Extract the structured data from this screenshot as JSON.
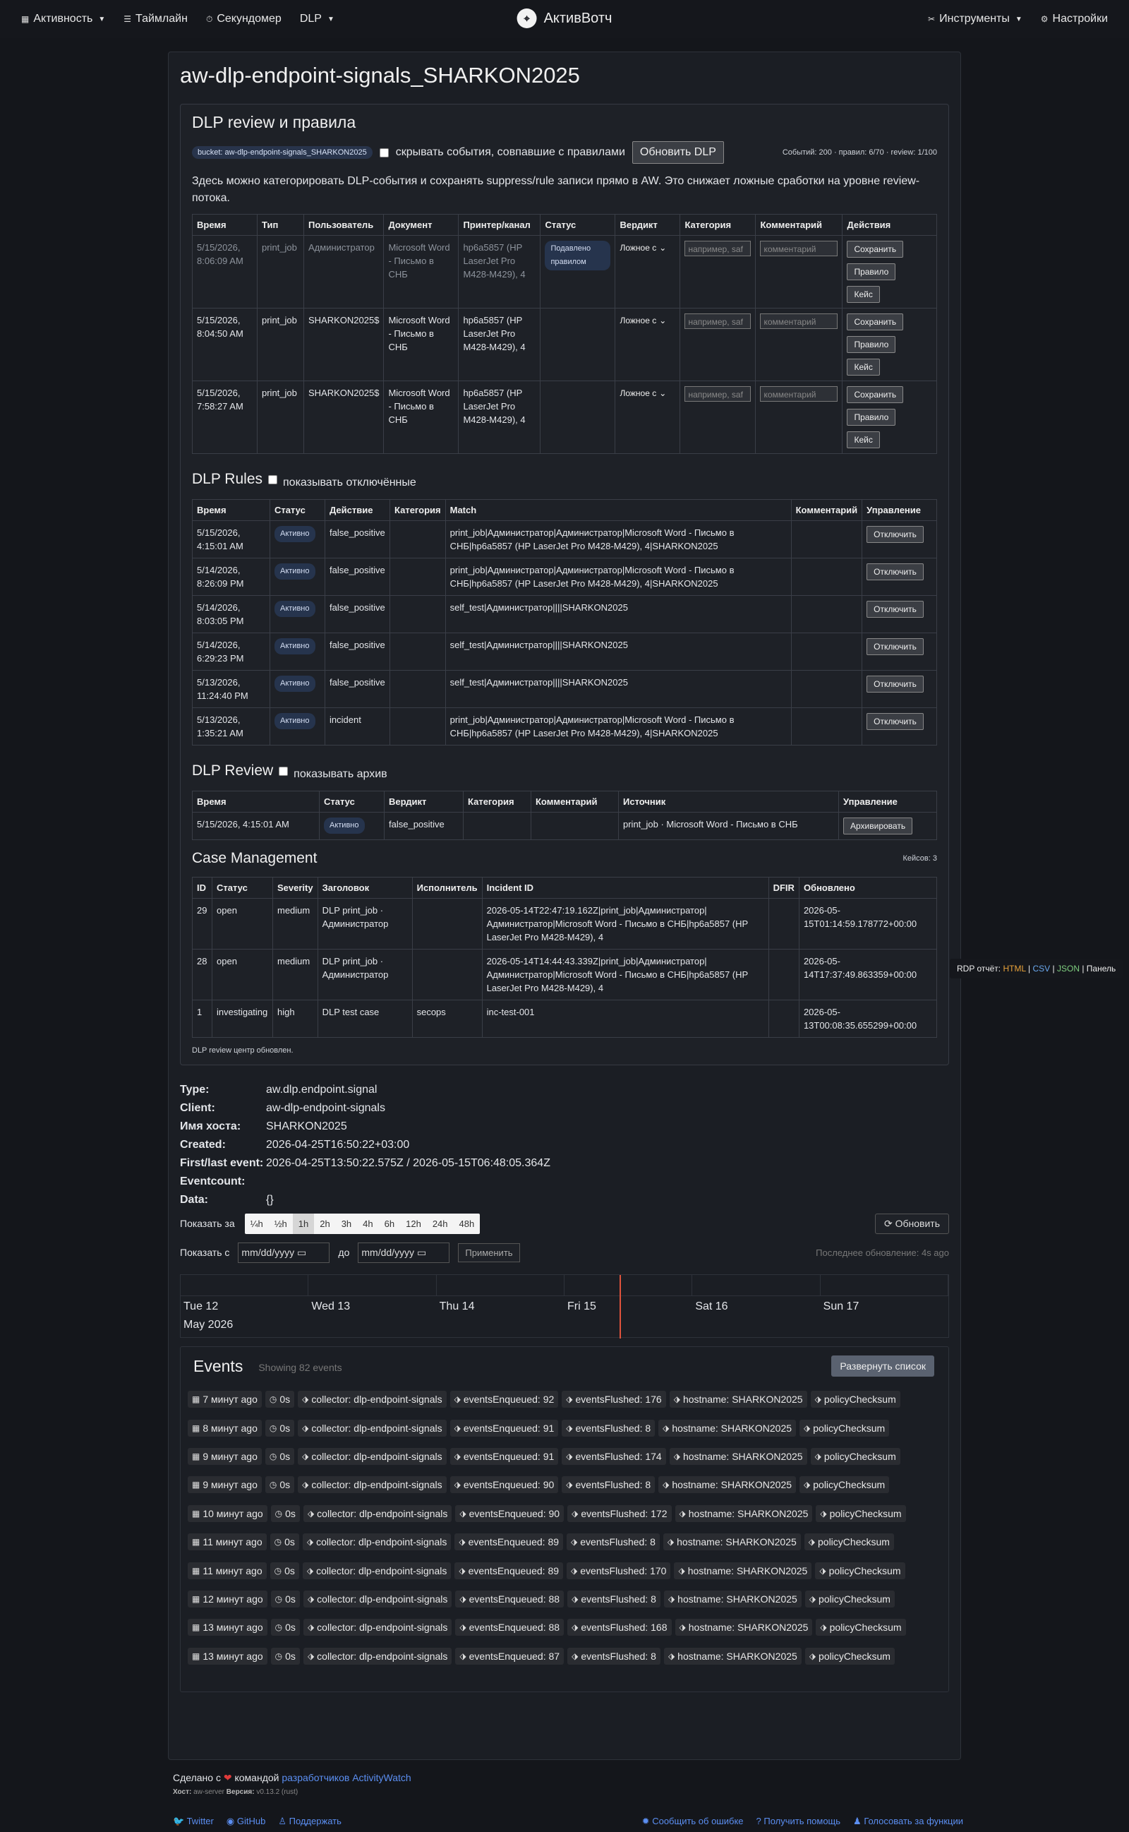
{
  "nav": {
    "left": [
      {
        "label": "Активность",
        "icon": "calendar-icon",
        "dropdown": true
      },
      {
        "label": "Таймлайн",
        "icon": "list-icon",
        "dropdown": false
      },
      {
        "label": "Секундомер",
        "icon": "stopwatch-icon",
        "dropdown": false
      },
      {
        "label": "DLP",
        "icon": "",
        "dropdown": true
      }
    ],
    "brand": "АктивВотч",
    "right": [
      {
        "label": "Инструменты",
        "icon": "tools-icon",
        "dropdown": true
      },
      {
        "label": "Настройки",
        "icon": "gear-icon",
        "dropdown": false
      }
    ]
  },
  "page_title": "aw-dlp-endpoint-signals_SHARKON2025",
  "review_panel": {
    "title": "DLP review и правила",
    "bucket_badge": "bucket: aw-dlp-endpoint-signals_SHARKON2025",
    "hide_label": "скрывать события, совпавшие с правилами",
    "refresh_button": "Обновить DLP",
    "stats": "Событий: 200 · правил: 6/70 · review: 1/100",
    "description": "Здесь можно категорировать DLP-события и сохранять suppress/rule записи прямо в AW. Это снижает ложные сработки на уровне review-потока.",
    "columns": [
      "Время",
      "Тип",
      "Пользователь",
      "Документ",
      "Принтер/канал",
      "Статус",
      "Вердикт",
      "Категория",
      "Комментарий",
      "Действия"
    ],
    "category_placeholder": "например, saf",
    "comment_placeholder": "комментарий",
    "verdict_value": "Ложное с",
    "actions": {
      "save": "Сохранить",
      "rule": "Правило",
      "case": "Кейс"
    },
    "rows": [
      {
        "time": "5/15/2026, 8:06:09 AM",
        "type": "print_job",
        "user": "Администратор",
        "doc": "Microsoft Word - Письмо в СНБ",
        "printer": "hp6a5857 (HP LaserJet Pro M428-M429), 4",
        "status": "Подавлено правилом",
        "dim": true
      },
      {
        "time": "5/15/2026, 8:04:50 AM",
        "type": "print_job",
        "user": "SHARKON2025$",
        "doc": "Microsoft Word - Письмо в СНБ",
        "printer": "hp6a5857 (HP LaserJet Pro M428-M429), 4",
        "status": "",
        "dim": false
      },
      {
        "time": "5/15/2026, 7:58:27 AM",
        "type": "print_job",
        "user": "SHARKON2025$",
        "doc": "Microsoft Word - Письмо в СНБ",
        "printer": "hp6a5857 (HP LaserJet Pro M428-M429), 4",
        "status": "",
        "dim": false
      }
    ]
  },
  "rules": {
    "title": "DLP Rules",
    "toggle_label": "показывать отключённые",
    "columns": [
      "Время",
      "Статус",
      "Действие",
      "Категория",
      "Match",
      "Комментарий",
      "Управление"
    ],
    "disable_button": "Отключить",
    "rows": [
      {
        "time": "5/15/2026, 4:15:01 AM",
        "status": "Активно",
        "action": "false_positive",
        "category": "",
        "match": "print_job|Администратор|Администратор|Microsoft Word - Письмо в СНБ|hp6a5857 (HP LaserJet Pro M428-M429), 4|SHARKON2025",
        "comment": ""
      },
      {
        "time": "5/14/2026, 8:26:09 PM",
        "status": "Активно",
        "action": "false_positive",
        "category": "",
        "match": "print_job|Администратор|Администратор|Microsoft Word - Письмо в СНБ|hp6a5857 (HP LaserJet Pro M428-M429), 4|SHARKON2025",
        "comment": ""
      },
      {
        "time": "5/14/2026, 8:03:05 PM",
        "status": "Активно",
        "action": "false_positive",
        "category": "",
        "match": "self_test|Администратор||||SHARKON2025",
        "comment": ""
      },
      {
        "time": "5/14/2026, 6:29:23 PM",
        "status": "Активно",
        "action": "false_positive",
        "category": "",
        "match": "self_test|Администратор||||SHARKON2025",
        "comment": ""
      },
      {
        "time": "5/13/2026, 11:24:40 PM",
        "status": "Активно",
        "action": "false_positive",
        "category": "",
        "match": "self_test|Администратор||||SHARKON2025",
        "comment": ""
      },
      {
        "time": "5/13/2026, 1:35:21 AM",
        "status": "Активно",
        "action": "incident",
        "category": "",
        "match": "print_job|Администратор|Администратор|Microsoft Word - Письмо в СНБ|hp6a5857 (HP LaserJet Pro M428-M429), 4|SHARKON2025",
        "comment": ""
      }
    ]
  },
  "review": {
    "title": "DLP Review",
    "toggle_label": "показывать архив",
    "columns": [
      "Время",
      "Статус",
      "Вердикт",
      "Категория",
      "Комментарий",
      "Источник",
      "Управление"
    ],
    "archive_button": "Архивировать",
    "rows": [
      {
        "time": "5/15/2026, 4:15:01 AM",
        "status": "Активно",
        "verdict": "false_positive",
        "category": "",
        "comment": "",
        "source": "print_job · Microsoft Word - Письмо в СНБ"
      }
    ]
  },
  "cases": {
    "title": "Case Management",
    "count": "Кейсов: 3",
    "columns": [
      "ID",
      "Статус",
      "Severity",
      "Заголовок",
      "Исполнитель",
      "Incident ID",
      "DFIR",
      "Обновлено"
    ],
    "rows": [
      {
        "id": "29",
        "status": "open",
        "severity": "medium",
        "title": "DLP print_job · Администратор",
        "assignee": "",
        "incident": "2026-05-14T22:47:19.162Z|print_job|Администратор|Администратор|Microsoft Word - Письмо в СНБ|hp6a5857 (HP LaserJet Pro M428-M429), 4",
        "dfir": "",
        "updated": "2026-05-15T01:14:59.178772+00:00"
      },
      {
        "id": "28",
        "status": "open",
        "severity": "medium",
        "title": "DLP print_job · Администратор",
        "assignee": "",
        "incident": "2026-05-14T14:44:43.339Z|print_job|Администратор|Администратор|Microsoft Word - Письмо в СНБ|hp6a5857 (HP LaserJet Pro M428-M429), 4",
        "dfir": "",
        "updated": "2026-05-14T17:37:49.863359+00:00"
      },
      {
        "id": "1",
        "status": "investigating",
        "severity": "high",
        "title": "DLP test case",
        "assignee": "secops",
        "incident": "inc-test-001",
        "dfir": "",
        "updated": "2026-05-13T00:08:35.655299+00:00"
      }
    ],
    "footnote": "DLP review центр обновлен."
  },
  "rdp": {
    "prefix": "RDP отчёт:",
    "html": "HTML",
    "csv": "CSV",
    "json": "JSON",
    "panel": "Панель"
  },
  "meta": [
    {
      "key": "Type:",
      "value": "aw.dlp.endpoint.signal"
    },
    {
      "key": "Client:",
      "value": "aw-dlp-endpoint-signals"
    },
    {
      "key": "Имя хоста:",
      "value": "SHARKON2025"
    },
    {
      "key": "Created:",
      "value": "2026-04-25T16:50:22+03:00"
    },
    {
      "key": "First/last event:",
      "value": "2026-04-25T13:50:22.575Z / 2026-05-15T06:48:05.364Z"
    },
    {
      "key": "Eventcount:",
      "value": ""
    },
    {
      "key": "Data:",
      "value": "{}"
    }
  ],
  "range": {
    "label": "Показать за",
    "options": [
      "¼h",
      "½h",
      "1h",
      "2h",
      "3h",
      "4h",
      "6h",
      "12h",
      "24h",
      "48h"
    ],
    "active_index": 2,
    "refresh": "Обновить"
  },
  "date_range": {
    "from_label": "Показать с",
    "to_label": "до",
    "placeholder": "mm/dd/yyyy",
    "apply": "Применить",
    "last_update": "Последнее обновление: 4s ago"
  },
  "timeline": {
    "days": [
      "Tue 12",
      "Wed 13",
      "Thu 14",
      "Fri 15",
      "Sat 16",
      "Sun 17"
    ],
    "month": "May 2026"
  },
  "events": {
    "title": "Events",
    "showing": "Showing 82 events",
    "expand_button": "Развернуть список",
    "rows": [
      {
        "ago": "7 минут ago",
        "dur": "0s",
        "collector": "collector: dlp-endpoint-signals",
        "enq": "eventsEnqueued: 92",
        "flush": "eventsFlushed: 176",
        "host": "hostname: SHARKON2025",
        "policy": "policyChecksum"
      },
      {
        "ago": "8 минут ago",
        "dur": "0s",
        "collector": "collector: dlp-endpoint-signals",
        "enq": "eventsEnqueued: 91",
        "flush": "eventsFlushed: 8",
        "host": "hostname: SHARKON2025",
        "policy": "policyChecksum"
      },
      {
        "ago": "9 минут ago",
        "dur": "0s",
        "collector": "collector: dlp-endpoint-signals",
        "enq": "eventsEnqueued: 91",
        "flush": "eventsFlushed: 174",
        "host": "hostname: SHARKON2025",
        "policy": "policyChecksum"
      },
      {
        "ago": "9 минут ago",
        "dur": "0s",
        "collector": "collector: dlp-endpoint-signals",
        "enq": "eventsEnqueued: 90",
        "flush": "eventsFlushed: 8",
        "host": "hostname: SHARKON2025",
        "policy": "policyChecksum"
      },
      {
        "ago": "10 минут ago",
        "dur": "0s",
        "collector": "collector: dlp-endpoint-signals",
        "enq": "eventsEnqueued: 90",
        "flush": "eventsFlushed: 172",
        "host": "hostname: SHARKON2025",
        "policy": "policyChecksum"
      },
      {
        "ago": "11 минут ago",
        "dur": "0s",
        "collector": "collector: dlp-endpoint-signals",
        "enq": "eventsEnqueued: 89",
        "flush": "eventsFlushed: 8",
        "host": "hostname: SHARKON2025",
        "policy": "policyChecksum"
      },
      {
        "ago": "11 минут ago",
        "dur": "0s",
        "collector": "collector: dlp-endpoint-signals",
        "enq": "eventsEnqueued: 89",
        "flush": "eventsFlushed: 170",
        "host": "hostname: SHARKON2025",
        "policy": "policyChecksum"
      },
      {
        "ago": "12 минут ago",
        "dur": "0s",
        "collector": "collector: dlp-endpoint-signals",
        "enq": "eventsEnqueued: 88",
        "flush": "eventsFlushed: 8",
        "host": "hostname: SHARKON2025",
        "policy": "policyChecksum"
      },
      {
        "ago": "13 минут ago",
        "dur": "0s",
        "collector": "collector: dlp-endpoint-signals",
        "enq": "eventsEnqueued: 88",
        "flush": "eventsFlushed: 168",
        "host": "hostname: SHARKON2025",
        "policy": "policyChecksum"
      },
      {
        "ago": "13 минут ago",
        "dur": "0s",
        "collector": "collector: dlp-endpoint-signals",
        "enq": "eventsEnqueued: 87",
        "flush": "eventsFlushed: 8",
        "host": "hostname: SHARKON2025",
        "policy": "policyChecksum"
      }
    ]
  },
  "footer": {
    "made_prefix": "Сделано с",
    "made_middle": "командой",
    "made_link": "разработчиков ActivityWatch",
    "host_label": "Хост:",
    "host_value": "aw-server",
    "version_label": "Версия:",
    "version_value": "v0.13.2 (rust)",
    "links_left": [
      "Twitter",
      "GitHub",
      "Поддержать"
    ],
    "links_right": [
      "Сообщить об ошибке",
      "Получить помощь",
      "Голосовать за функции"
    ]
  }
}
